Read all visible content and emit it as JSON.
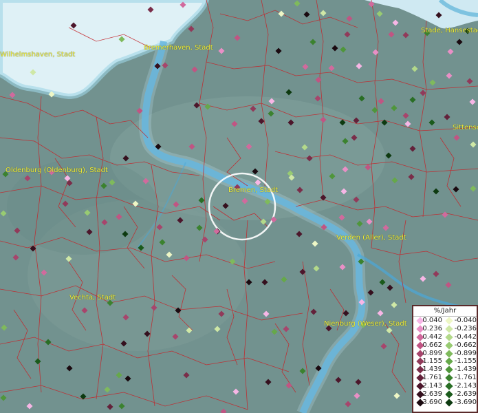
{
  "map": {
    "cities": [
      {
        "name": "Wilhelmshaven, Stadt"
      },
      {
        "name": "Bremerhaven, Stadt"
      },
      {
        "name": "Stade, Hansestadt"
      },
      {
        "name": "Sittensen"
      },
      {
        "name": "Oldenburg (Oldenburg), Stadt"
      },
      {
        "name": "Bremen, Stadt"
      },
      {
        "name": "Verden (Aller), Stadt"
      },
      {
        "name": "Vechta, Stadt"
      },
      {
        "name": "Nienburg (Weser), Stadt"
      }
    ]
  },
  "legend": {
    "title": "%/Jahr",
    "positive": [
      "0.040",
      "0.236",
      "0.442",
      "0.662",
      "0.899",
      "1.155",
      "1.439",
      "1.761",
      "2.143",
      "2.639",
      "3.690"
    ],
    "negative": [
      "-0.040",
      "-0.236",
      "-0.442",
      "-0.662",
      "-0.899",
      "-1.155",
      "-1.439",
      "-1.761",
      "-2.143",
      "-2.639",
      "-3.690"
    ],
    "positive_colors": [
      "#f7b6e6",
      "#e98fc6",
      "#d16a9d",
      "#c05583",
      "#a7456c",
      "#913a5a",
      "#7a2d49",
      "#63213a",
      "#4c162b",
      "#35101e",
      "#1a0a10"
    ],
    "negative_colors": [
      "#eef7c6",
      "#cfe8a6",
      "#b3d98a",
      "#98cb72",
      "#7fba5c",
      "#66a84a",
      "#4f963b",
      "#3b822f",
      "#296e25",
      "#1a5a1b",
      "#0d3a10"
    ]
  }
}
